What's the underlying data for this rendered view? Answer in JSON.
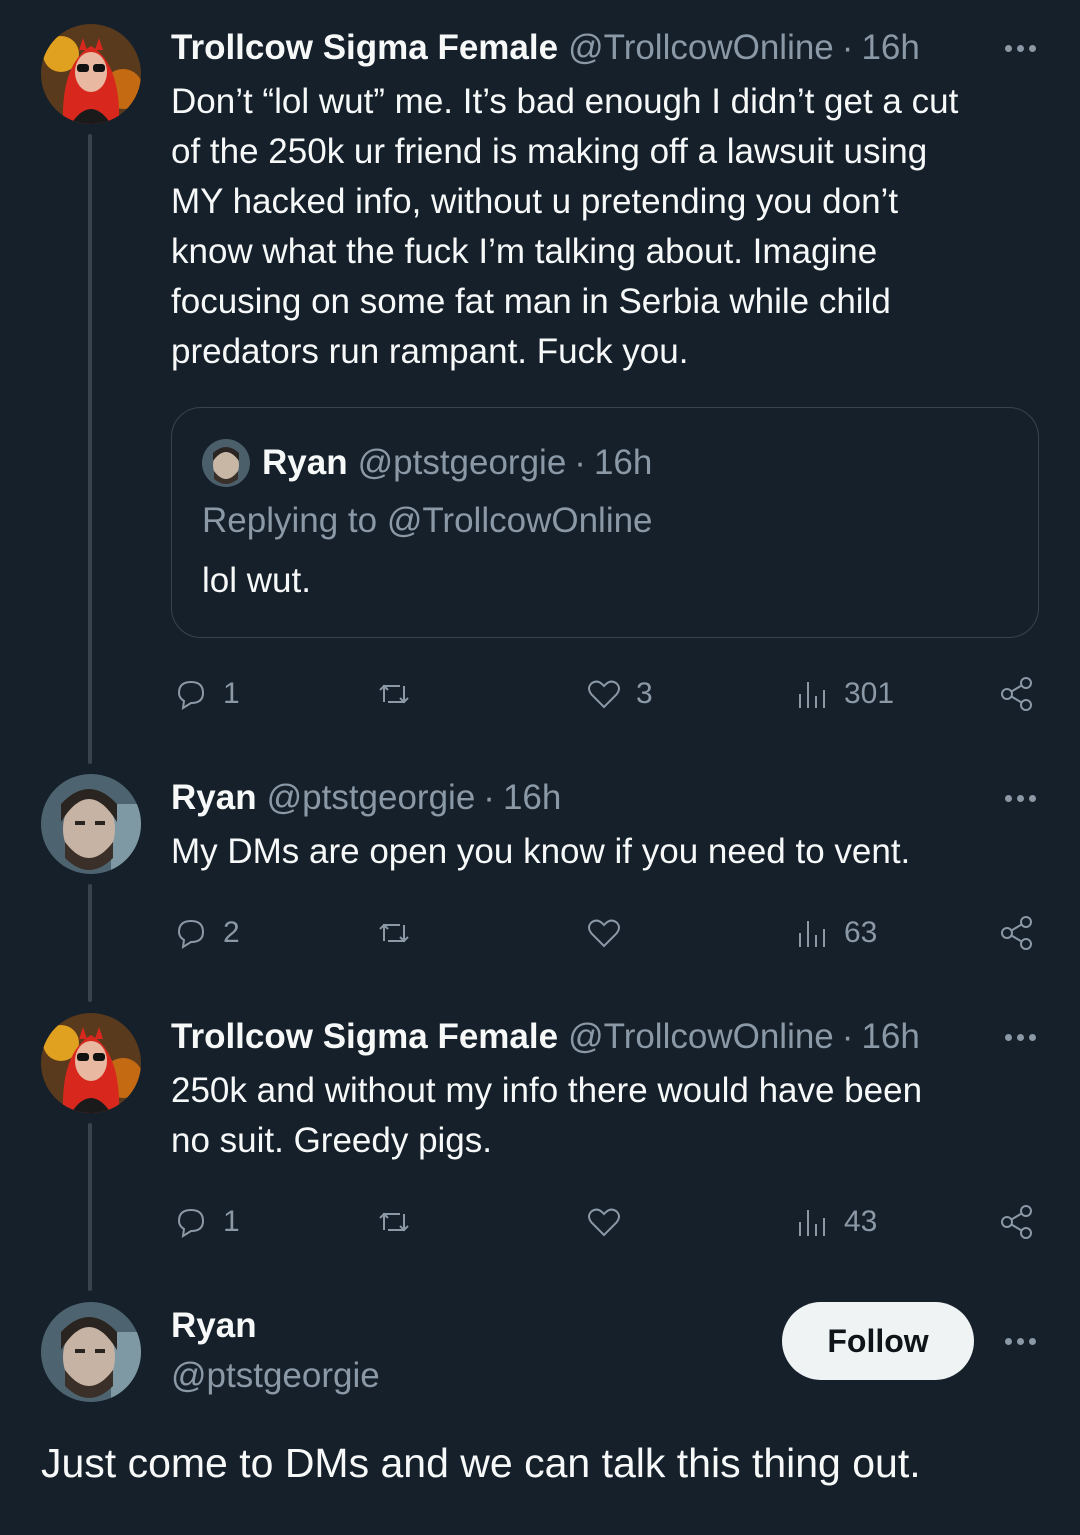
{
  "colors": {
    "background": "#15202b",
    "text": "#f7f9f9",
    "muted": "#8b98a5",
    "border": "#38444d"
  },
  "tweets": [
    {
      "name": "Trollcow Sigma Female",
      "handle": "@TrollcowOnline",
      "dot": "·",
      "time": "16h",
      "text": "Don’t “lol wut” me. It’s bad enough I didn’t get a cut\nof the 250k ur friend is making off a lawsuit using\nMY hacked info, without u pretending you don’t\nknow what the fuck I’m talking about. Imagine\nfocusing on some fat man in Serbia while child\npredators run rampant. Fuck you.",
      "quote": {
        "name": "Ryan",
        "handle": "@ptstgeorgie",
        "dot": "·",
        "time": "16h",
        "replying": "Replying to @TrollcowOnline",
        "text": "lol wut."
      },
      "actions": {
        "replies": "1",
        "retweets": "",
        "likes": "3",
        "views": "301"
      }
    },
    {
      "name": "Ryan",
      "handle": "@ptstgeorgie",
      "dot": "·",
      "time": "16h",
      "text": "My DMs are open you know if you need to vent.",
      "actions": {
        "replies": "2",
        "retweets": "",
        "likes": "",
        "views": "63"
      }
    },
    {
      "name": "Trollcow Sigma Female",
      "handle": "@TrollcowOnline",
      "dot": "·",
      "time": "16h",
      "text": "250k and without my info there would have been\nno suit. Greedy pigs.",
      "actions": {
        "replies": "1",
        "retweets": "",
        "likes": "",
        "views": "43"
      }
    }
  ],
  "main_tweet": {
    "name": "Ryan",
    "handle": "@ptstgeorgie",
    "follow_label": "Follow",
    "text": "Just come to DMs and we can talk this thing out."
  },
  "icons": [
    "reply-icon",
    "retweet-icon",
    "like-icon",
    "views-icon",
    "share-icon",
    "more-icon"
  ]
}
